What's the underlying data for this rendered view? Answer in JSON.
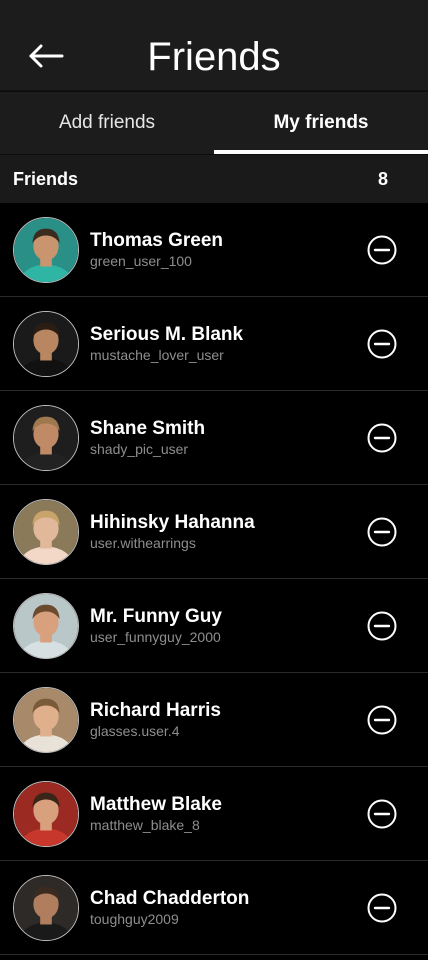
{
  "header": {
    "title": "Friends",
    "back_icon": "arrow-left-icon"
  },
  "tabs": [
    {
      "label": "Add friends",
      "active": false
    },
    {
      "label": "My friends",
      "active": true
    }
  ],
  "section": {
    "title": "Friends",
    "count": "8"
  },
  "friends": [
    {
      "name": "Thomas Green",
      "username": "green_user_100",
      "avatar_bg": "#2a8f86",
      "avatar_skin": "#c9956e",
      "avatar_hair": "#3b2a1e",
      "avatar_shirt": "#2fb5a3"
    },
    {
      "name": "Serious M. Blank",
      "username": "mustache_lover_user",
      "avatar_bg": "#1a1a1a",
      "avatar_skin": "#b88660",
      "avatar_hair": "#2a1d14",
      "avatar_shirt": "#111111"
    },
    {
      "name": "Shane Smith",
      "username": "shady_pic_user",
      "avatar_bg": "#1e1e1e",
      "avatar_skin": "#c08a66",
      "avatar_hair": "#a07850",
      "avatar_shirt": "#222222"
    },
    {
      "name": "Hihinsky Hahanna",
      "username": "user.withearrings",
      "avatar_bg": "#8a7a5a",
      "avatar_skin": "#e2b89a",
      "avatar_hair": "#c9a46a",
      "avatar_shirt": "#f3d8c8"
    },
    {
      "name": "Mr. Funny Guy",
      "username": "user_funnyguy_2000",
      "avatar_bg": "#b9c7c9",
      "avatar_skin": "#d9a07e",
      "avatar_hair": "#6b4a2e",
      "avatar_shirt": "#d6e0e2"
    },
    {
      "name": "Richard Harris",
      "username": "glasses.user.4",
      "avatar_bg": "#a88a6a",
      "avatar_skin": "#e0b08c",
      "avatar_hair": "#7a5a38",
      "avatar_shirt": "#e8e2d8"
    },
    {
      "name": "Matthew Blake",
      "username": "matthew_blake_8",
      "avatar_bg": "#9a2a22",
      "avatar_skin": "#d9a07e",
      "avatar_hair": "#3a2618",
      "avatar_shirt": "#c8372c"
    },
    {
      "name": "Chad Chadderton",
      "username": "toughguy2009",
      "avatar_bg": "#2e2a28",
      "avatar_skin": "#b07e5e",
      "avatar_hair": "#3a2a20",
      "avatar_shirt": "#1a1a1a"
    }
  ],
  "remove_icon": "minus-circle-icon",
  "colors": {
    "background": "#000000",
    "header_bg": "#1c1c1c",
    "text_primary": "#ffffff",
    "text_secondary": "#8e8e8e",
    "divider": "#2a2a2a"
  }
}
